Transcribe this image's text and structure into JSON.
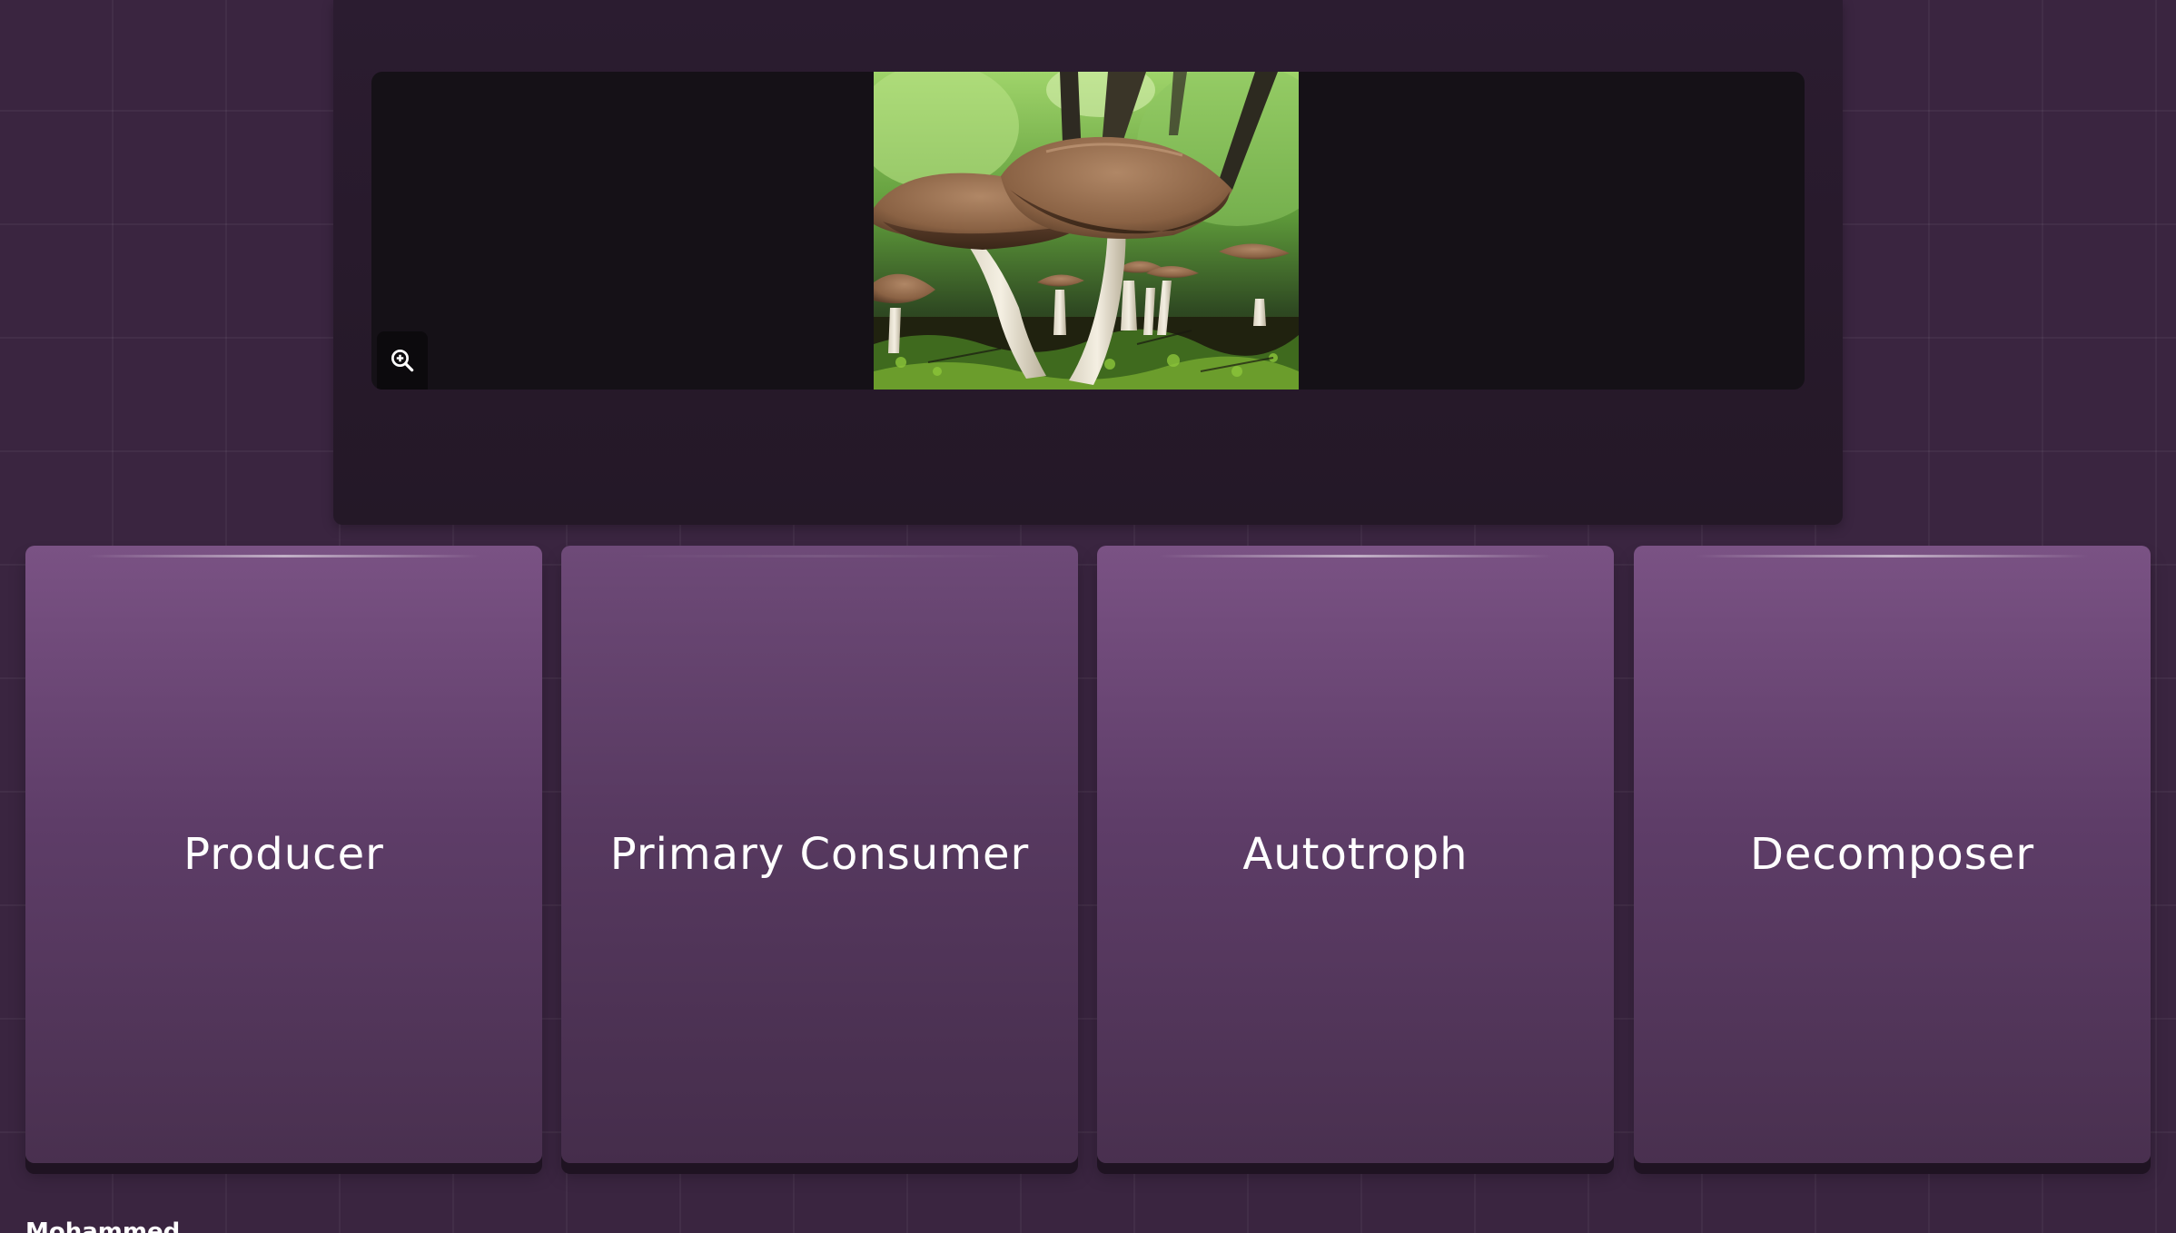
{
  "question": {
    "image_alt": "Mushrooms growing on a mossy forest floor",
    "zoom_icon": "zoom-in-icon"
  },
  "answers": [
    {
      "label": "Producer"
    },
    {
      "label": "Primary Consumer"
    },
    {
      "label": "Autotroph"
    },
    {
      "label": "Decomposer"
    }
  ],
  "player": {
    "name": "Mohammed"
  },
  "colors": {
    "background": "#3a2540",
    "panel": "#2b1c30",
    "card_top": "#7a5284",
    "card_bottom": "#49304f"
  }
}
